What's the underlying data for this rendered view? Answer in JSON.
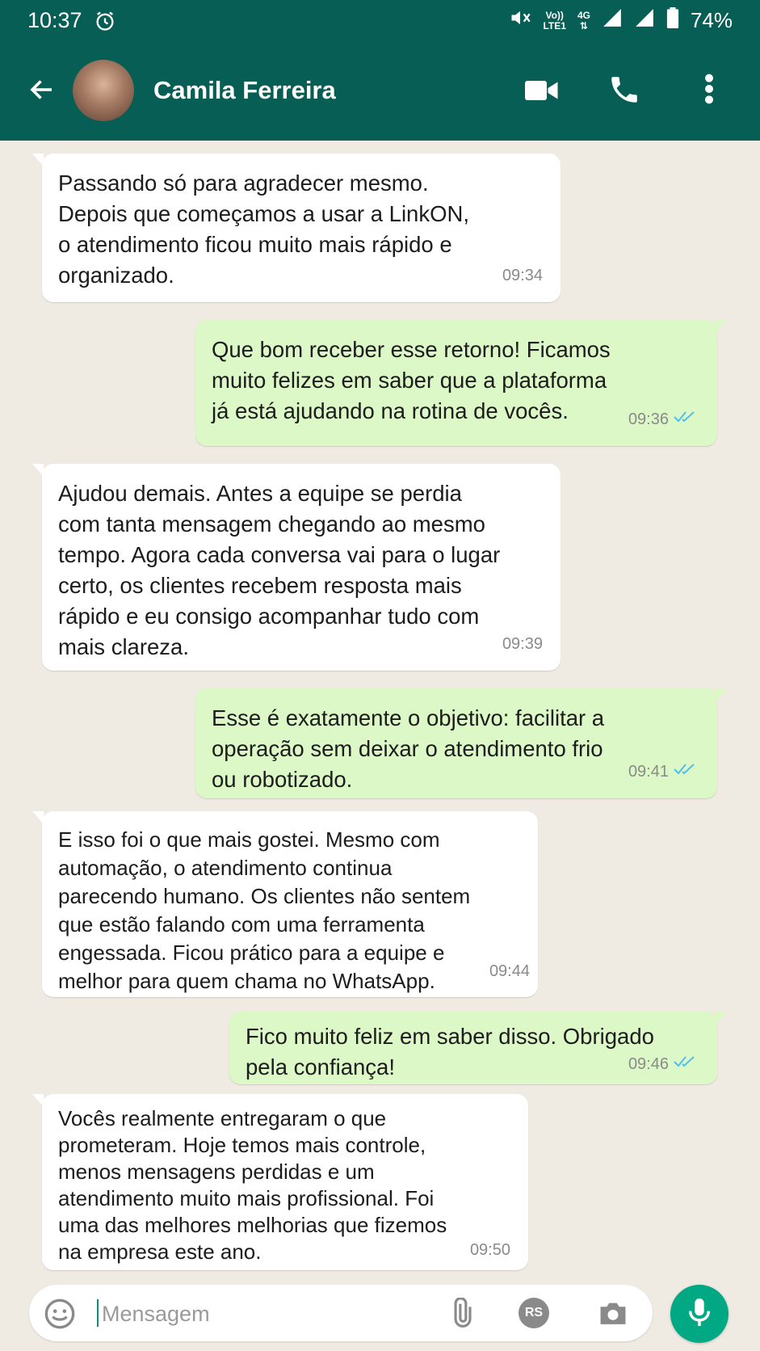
{
  "status_bar": {
    "time": "10:37",
    "net_top": "Vo))",
    "net_bottom": "LTE1",
    "net_4g": "4G",
    "battery": "74%",
    "icons": [
      "alarm-icon",
      "mute-icon",
      "signal-icon",
      "battery-icon"
    ]
  },
  "header": {
    "contact_name": "Camila Ferreira",
    "icons": [
      "back-arrow-icon",
      "video-call-icon",
      "phone-icon",
      "more-vert-icon"
    ],
    "color": "#075e54"
  },
  "messages": [
    {
      "direction": "in",
      "lines": [
        "Passando só para agradecer mesmo.",
        "Depois que começamos a usar a LinkON,",
        "o atendimento ficou muito mais rápido e",
        "organizado."
      ],
      "time": "09:34"
    },
    {
      "direction": "out",
      "lines": [
        "Que bom receber esse retorno! Ficamos",
        "muito felizes em saber que a plataforma",
        "já está ajudando na rotina de vocês."
      ],
      "time": "09:36",
      "read": true
    },
    {
      "direction": "in",
      "lines": [
        "Ajudou demais. Antes a equipe se perdia",
        "com tanta mensagem chegando ao mesmo",
        "tempo. Agora cada conversa vai para o lugar",
        "certo, os clientes recebem resposta mais",
        "rápido e eu consigo acompanhar tudo com",
        "mais clareza."
      ],
      "time": "09:39"
    },
    {
      "direction": "out",
      "lines": [
        "Esse é exatamente o objetivo: facilitar a",
        "operação sem deixar o atendimento frio",
        "ou robotizado."
      ],
      "time": "09:41",
      "read": true
    },
    {
      "direction": "in",
      "lines": [
        "E isso foi o que mais gostei. Mesmo com",
        "automação, o atendimento continua",
        "parecendo humano. Os clientes não sentem",
        "que estão falando com uma ferramenta",
        "engessada. Ficou prático para a equipe e",
        "melhor para quem chama no WhatsApp."
      ],
      "time": "09:44"
    },
    {
      "direction": "out",
      "lines": [
        "Fico muito feliz em saber disso. Obrigado",
        "pela confiança!"
      ],
      "time": "09:46",
      "read": true
    },
    {
      "direction": "in",
      "lines": [
        "Vocês realmente entregaram o que",
        "prometeram. Hoje temos mais controle,",
        "menos mensagens perdidas e um",
        "atendimento muito mais profissional. Foi",
        "uma das melhores melhorias que fizemos",
        "na empresa este ano."
      ],
      "time": "09:50"
    }
  ],
  "composer": {
    "placeholder": "Mensagem",
    "rs_label": "RS",
    "icons": [
      "emoji-icon",
      "attach-icon",
      "camera-icon",
      "mic-icon"
    ]
  },
  "colors": {
    "incoming_bubble": "#ffffff",
    "outgoing_bubble": "#dcf8c6",
    "chat_background": "#efeae2",
    "read_ticks": "#53bdeb",
    "mic_button": "#00a884"
  }
}
